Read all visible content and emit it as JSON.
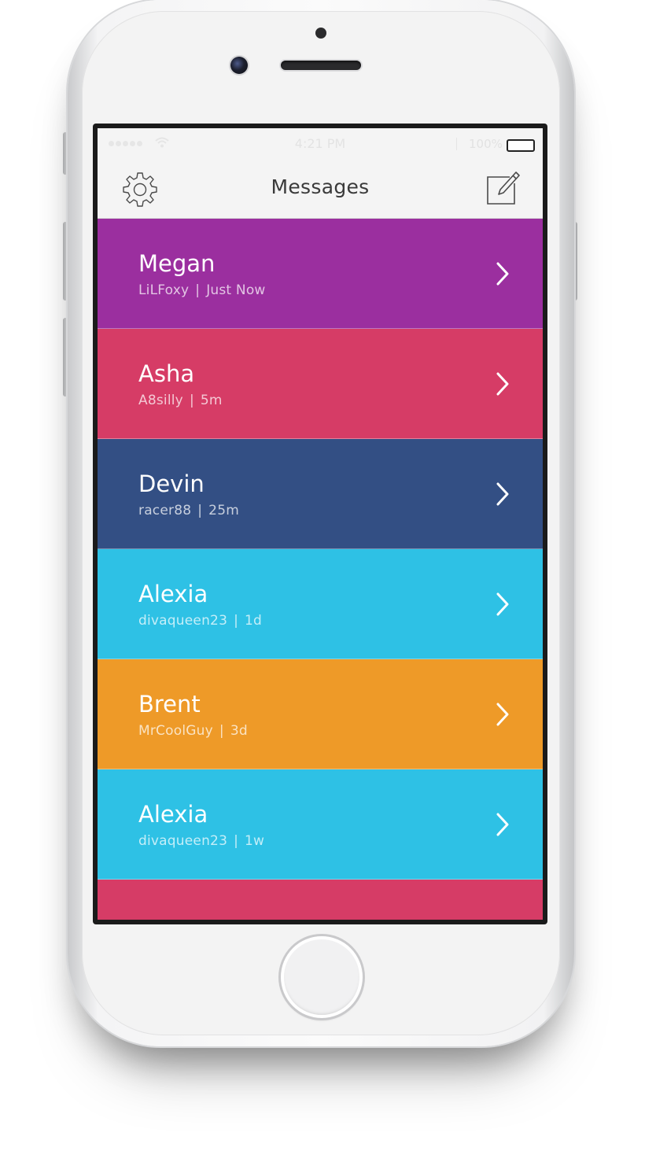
{
  "status_bar": {
    "time": "4:21 PM",
    "battery_percent": "100%"
  },
  "navbar": {
    "title": "Messages",
    "settings_icon": "gear-icon",
    "compose_icon": "compose-icon"
  },
  "messages": [
    {
      "name": "Megan",
      "username": "LiLFoxy",
      "time": "Just Now",
      "color": "#9b2f9f"
    },
    {
      "name": "Asha",
      "username": "A8silly",
      "time": "5m",
      "color": "#d63c66"
    },
    {
      "name": "Devin",
      "username": "racer88",
      "time": "25m",
      "color": "#334f84"
    },
    {
      "name": "Alexia",
      "username": "divaqueen23",
      "time": "1d",
      "color": "#2ec1e5"
    },
    {
      "name": "Brent",
      "username": "MrCoolGuy",
      "time": "3d",
      "color": "#ee9a28"
    },
    {
      "name": "Alexia",
      "username": "divaqueen23",
      "time": "1w",
      "color": "#2ec1e5"
    }
  ],
  "separator": "|",
  "peek_row_color": "#d63c66"
}
